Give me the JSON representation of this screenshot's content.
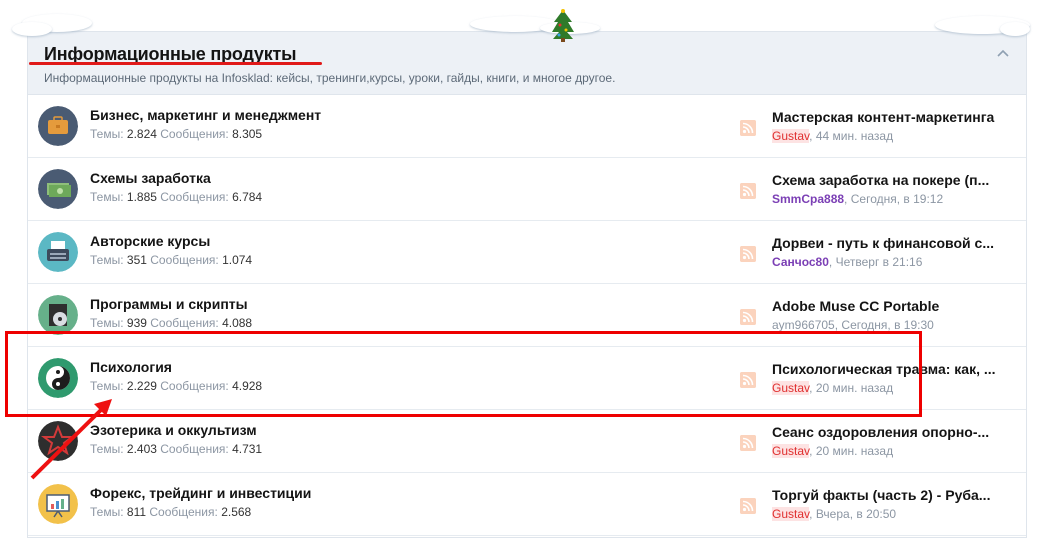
{
  "forum_block": {
    "title": "Информационные продукты",
    "description": "Информационные продукты на Infosklad: кейсы, тренинги,курсы, уроки, гайды, книги, и многое другое.",
    "collapse_icon": "chevron-up-icon"
  },
  "stats_labels": {
    "threads": "Темы:",
    "messages": "Сообщения:"
  },
  "nodes": [
    {
      "title": "Бизнес, маркетинг и менеджмент",
      "threads": "2.824",
      "messages": "8.305",
      "icon": "briefcase-icon",
      "last_title": "Мастерская контент-маркетинга",
      "last_user": "Gustav",
      "last_time": "44 мин. назад"
    },
    {
      "title": "Схемы заработка",
      "threads": "1.885",
      "messages": "6.784",
      "icon": "money-icon",
      "last_title": "Схема заработка на покере (п...",
      "last_user": "SmmCpa888",
      "last_time": "Сегодня, в 19:12"
    },
    {
      "title": "Авторские курсы",
      "threads": "351",
      "messages": "1.074",
      "icon": "typewriter-icon",
      "last_title": "Дорвеи - путь к финансовой с...",
      "last_user": "Санчос80",
      "last_time": "Четверг в 21:16"
    },
    {
      "title": "Программы и скрипты",
      "threads": "939",
      "messages": "4.088",
      "icon": "disc-icon",
      "last_title": "Adobe Muse CC Portable",
      "last_user": "aym966705",
      "last_time": "Сегодня, в 19:30"
    },
    {
      "title": "Психология",
      "threads": "2.229",
      "messages": "4.928",
      "icon": "yin-yang-icon",
      "last_title": "Психологическая травма: как, ...",
      "last_user": "Gustav",
      "last_time": "20 мин. назад"
    },
    {
      "title": "Эзотерика и оккультизм",
      "threads": "2.403",
      "messages": "4.731",
      "icon": "pentagram-icon",
      "last_title": "Сеанс оздоровления опорно-...",
      "last_user": "Gustav",
      "last_time": "20 мин. назад"
    },
    {
      "title": "Форекс, трейдинг и инвестиции",
      "threads": "811",
      "messages": "2.568",
      "icon": "chart-board-icon",
      "last_title": "Торгуй факты (часть 2) - Руба...",
      "last_user": "Gustav",
      "last_time": "Вчера, в 20:50"
    }
  ],
  "sep": ","
}
